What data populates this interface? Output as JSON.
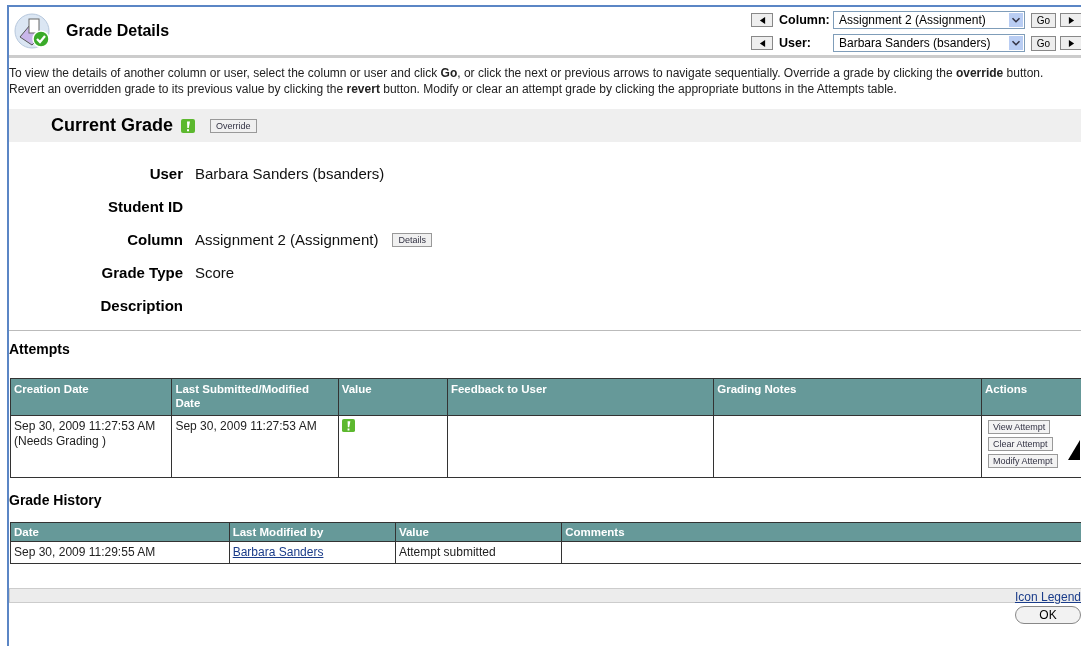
{
  "header": {
    "title": "Grade Details"
  },
  "navigators": [
    {
      "label": "Column:",
      "value": "Assignment 2 (Assignment)",
      "go": "Go"
    },
    {
      "label": "User:",
      "value": "Barbara Sanders (bsanders)",
      "go": "Go"
    }
  ],
  "instructions": "To view the details of another column or user, select the column or user and click **Go**, or click the next or previous arrows to navigate sequentially. Override a grade by clicking the **override** button. Revert an overridden grade to its previous value by clicking the **revert** button. Modify or clear an attempt grade by clicking the appropriate buttons in the Attempts table.",
  "current_grade": {
    "title": "Current Grade",
    "needs_grading": true,
    "button": "Override"
  },
  "details": [
    {
      "label": "User",
      "value": "Barbara Sanders (bsanders)"
    },
    {
      "label": "Student ID"
    },
    {
      "label": "Column",
      "value": "Assignment 2 (Assignment)",
      "button": "Details"
    },
    {
      "label": "Grade Type",
      "value": "Score"
    },
    {
      "label": "Description"
    }
  ],
  "attempts": {
    "title": "Attempts",
    "columns": [
      "Creation Date",
      "Last Submitted/Modified Date",
      "Value",
      "Feedback to User",
      "Grading Notes",
      "Actions"
    ],
    "rows": [
      {
        "creation_date": "Sep 30, 2009 11:27:53 AM",
        "creation_note": "(Needs Grading )",
        "last_modified": "Sep 30, 2009 11:27:53 AM",
        "needs_grading": true,
        "actions": [
          "View Attempt",
          "Clear Attempt",
          "Modify Attempt"
        ]
      }
    ]
  },
  "grade_history": {
    "title": "Grade History",
    "columns": [
      "Date",
      "Last Modified by",
      "Value",
      "Comments"
    ],
    "rows": [
      {
        "date": "Sep 30, 2009 11:29:55 AM",
        "modified_by": "Barbara Sanders",
        "value": "Attempt submitted"
      }
    ]
  },
  "footer": {
    "link": "Icon Legend",
    "button": "OK"
  }
}
